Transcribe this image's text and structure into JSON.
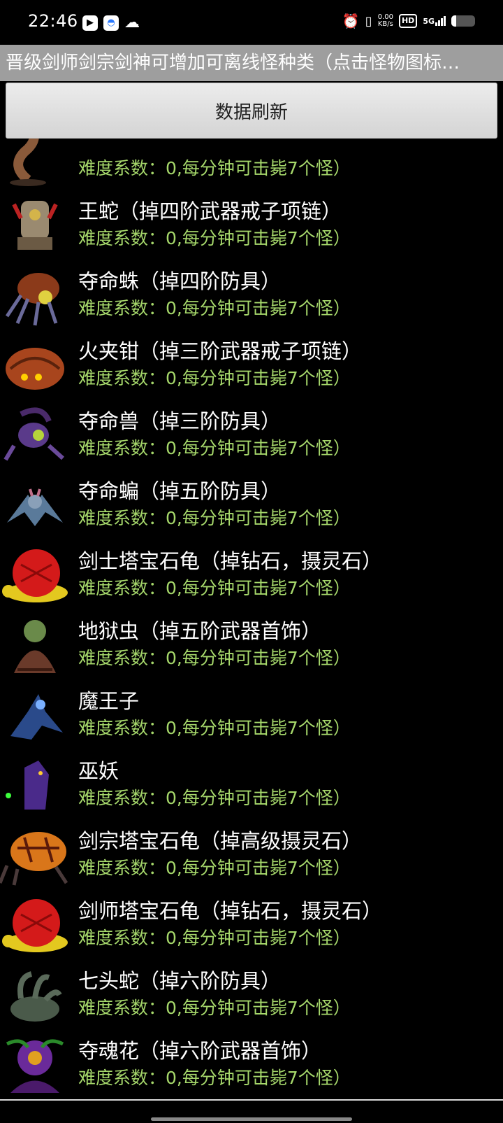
{
  "status_bar": {
    "time": "22:46",
    "net_speed_value": "0.00",
    "net_speed_unit": "KB/s",
    "hd": "HD",
    "signal": "5G",
    "icons": [
      "play-icon",
      "app-icon",
      "cloud-icon",
      "alarm-icon",
      "vibrate-icon",
      "signal-icon",
      "battery-icon"
    ],
    "battery_level": 0.22
  },
  "notice": {
    "text": "晋级剑师剑宗剑神可增加可离线怪种类（点击怪物图标…"
  },
  "refresh_button": {
    "label": "数据刷新"
  },
  "monsters": [
    {
      "name": "",
      "info": "难度系数：0,每分钟可击毙7个怪）",
      "icon": "worm-monster-icon"
    },
    {
      "name": "王蛇（掉四阶武器戒子项链）",
      "info": "难度系数：0,每分钟可击毙7个怪）",
      "icon": "king-snake-icon"
    },
    {
      "name": "夺命蛛（掉四阶防具）",
      "info": "难度系数：0,每分钟可击毙7个怪）",
      "icon": "spider-icon"
    },
    {
      "name": "火夹钳（掉三阶武器戒子项链）",
      "info": "难度系数：0,每分钟可击毙7个怪）",
      "icon": "fire-pincer-icon"
    },
    {
      "name": "夺命兽（掉三阶防具）",
      "info": "难度系数：0,每分钟可击毙7个怪）",
      "icon": "scorpion-beast-icon"
    },
    {
      "name": "夺命蝙（掉五阶防具）",
      "info": "难度系数：0,每分钟可击毙7个怪）",
      "icon": "bat-icon"
    },
    {
      "name": "剑士塔宝石龟（掉钻石，摄灵石）",
      "info": "难度系数：0,每分钟可击毙7个怪）",
      "icon": "gem-turtle-icon"
    },
    {
      "name": "地狱虫（掉五阶武器首饰）",
      "info": "难度系数：0,每分钟可击毙7个怪）",
      "icon": "hell-bug-icon"
    },
    {
      "name": "魔王子",
      "info": "难度系数：0,每分钟可击毙7个怪）",
      "icon": "demon-prince-icon"
    },
    {
      "name": "巫妖",
      "info": "难度系数：0,每分钟可击毙7个怪）",
      "icon": "lich-icon"
    },
    {
      "name": "剑宗塔宝石龟（掉高级摄灵石）",
      "info": "难度系数：0,每分钟可击毙7个怪）",
      "icon": "lava-turtle-icon"
    },
    {
      "name": "剑师塔宝石龟（掉钻石，摄灵石）",
      "info": "难度系数：0,每分钟可击毙7个怪）",
      "icon": "gem-turtle-icon"
    },
    {
      "name": "七头蛇（掉六阶防具）",
      "info": "难度系数：0,每分钟可击毙7个怪）",
      "icon": "hydra-icon"
    },
    {
      "name": "夺魂花（掉六阶武器首饰）",
      "info": "难度系数：0,每分钟可击毙7个怪）",
      "icon": "soul-flower-icon"
    }
  ]
}
